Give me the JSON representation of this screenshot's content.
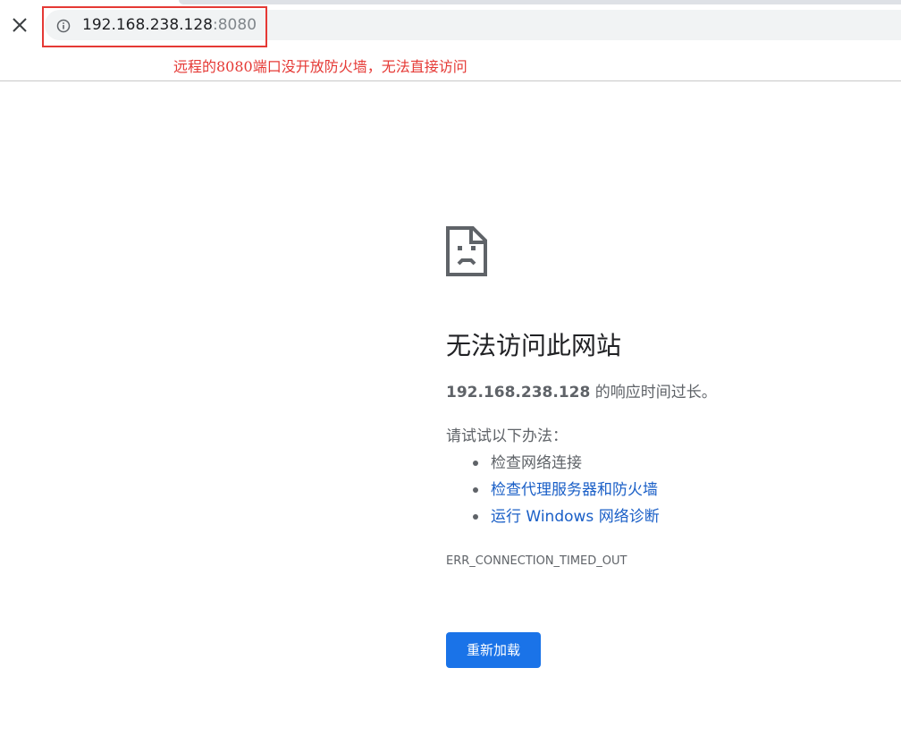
{
  "toolbar": {
    "url_host": "192.168.238.128",
    "url_port": ":8080",
    "info_icon": "info-icon",
    "close_icon": "close-icon"
  },
  "annotation": {
    "text": "远程的8080端口没开放防火墙，无法直接访问",
    "color": "#e53935"
  },
  "error_page": {
    "icon": "sad-document-icon",
    "heading": "无法访问此网站",
    "summary_host": "192.168.238.128",
    "summary_rest": " 的响应时间过长。",
    "suggestions_title": "请试试以下办法：",
    "suggestions": [
      {
        "label": "检查网络连接",
        "is_link": false
      },
      {
        "label": "检查代理服务器和防火墙",
        "is_link": true
      },
      {
        "label": "运行 Windows 网络诊断",
        "is_link": true
      }
    ],
    "error_code": "ERR_CONNECTION_TIMED_OUT",
    "reload_label": "重新加载"
  },
  "colors": {
    "link": "#1a5fc7",
    "button": "#1a73e8",
    "text_secondary": "#5f6368"
  }
}
